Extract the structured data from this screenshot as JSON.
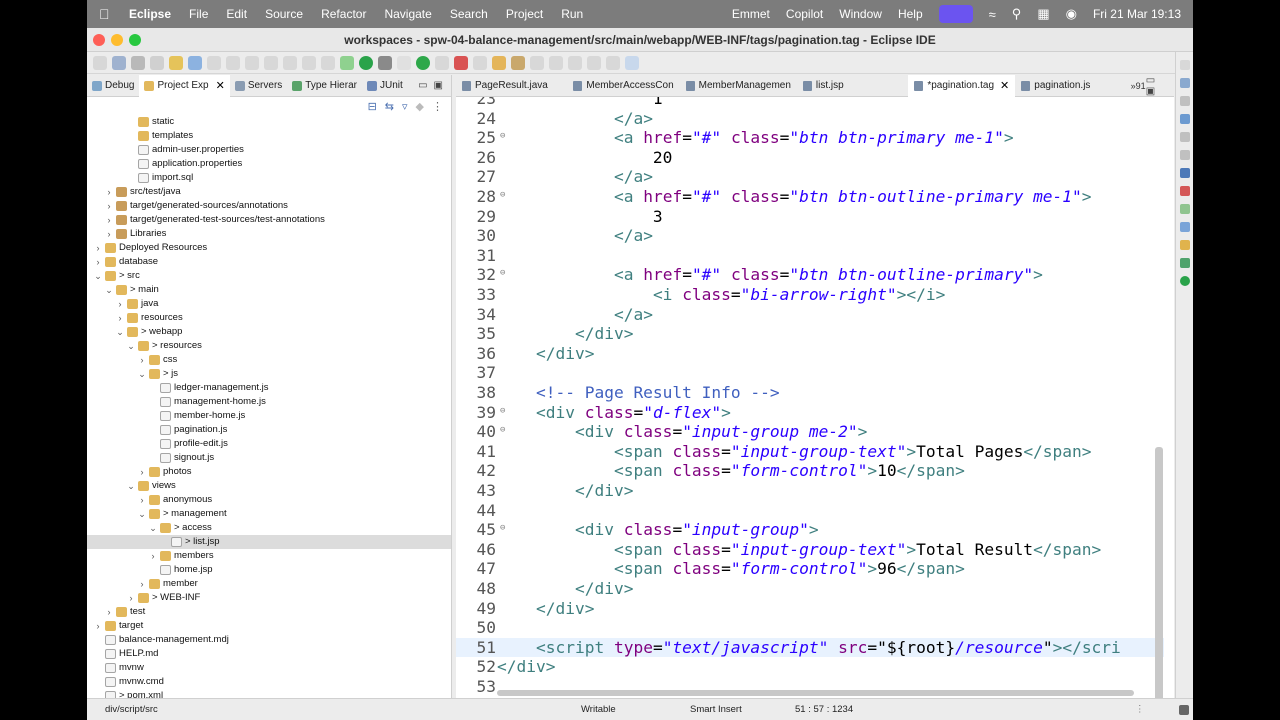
{
  "menubar": {
    "app_name": "Eclipse",
    "items": [
      "File",
      "Edit",
      "Source",
      "Refactor",
      "Navigate",
      "Search",
      "Project",
      "Run"
    ],
    "right_items": [
      "Emmet",
      "Copilot",
      "Window",
      "Help"
    ],
    "datetime": "Fri 21 Mar  19:13"
  },
  "window": {
    "title": "workspaces - spw-04-balance-management/src/main/webapp/WEB-INF/tags/pagination.tag - Eclipse IDE"
  },
  "left_tabs": [
    {
      "label": "Debug",
      "icon": "bug-icon"
    },
    {
      "label": "Project Exp",
      "icon": "project-explorer-icon",
      "active": true
    },
    {
      "label": "Servers",
      "icon": "servers-icon"
    },
    {
      "label": "Type Hierar",
      "icon": "type-hierarchy-icon"
    },
    {
      "label": "JUnit",
      "icon": "junit-icon"
    }
  ],
  "tree": [
    {
      "label": "static",
      "depth": 3,
      "kind": "folder"
    },
    {
      "label": "templates",
      "depth": 3,
      "kind": "folder"
    },
    {
      "label": "admin-user.properties",
      "depth": 3,
      "kind": "file"
    },
    {
      "label": "application.properties",
      "depth": 3,
      "kind": "file"
    },
    {
      "label": "import.sql",
      "depth": 3,
      "kind": "file"
    },
    {
      "label": "src/test/java",
      "depth": 1,
      "kind": "proj",
      "twisty": ">"
    },
    {
      "label": "target/generated-sources/annotations",
      "depth": 1,
      "kind": "proj",
      "twisty": ">"
    },
    {
      "label": "target/generated-test-sources/test-annotations",
      "depth": 1,
      "kind": "proj",
      "twisty": ">"
    },
    {
      "label": "Libraries",
      "depth": 1,
      "kind": "proj",
      "twisty": ">"
    },
    {
      "label": "Deployed Resources",
      "depth": 0,
      "kind": "folder",
      "twisty": ">"
    },
    {
      "label": "database",
      "depth": 0,
      "kind": "folder",
      "twisty": ">"
    },
    {
      "label": "> src",
      "depth": 0,
      "kind": "folder",
      "twisty": "v"
    },
    {
      "label": "> main",
      "depth": 1,
      "kind": "folder",
      "twisty": "v"
    },
    {
      "label": "java",
      "depth": 2,
      "kind": "folder",
      "twisty": ">"
    },
    {
      "label": "resources",
      "depth": 2,
      "kind": "folder",
      "twisty": ">"
    },
    {
      "label": "> webapp",
      "depth": 2,
      "kind": "folder",
      "twisty": "v"
    },
    {
      "label": "> resources",
      "depth": 3,
      "kind": "folder",
      "twisty": "v"
    },
    {
      "label": "css",
      "depth": 4,
      "kind": "folder",
      "twisty": ">"
    },
    {
      "label": "> js",
      "depth": 4,
      "kind": "folder",
      "twisty": "v"
    },
    {
      "label": "ledger-management.js",
      "depth": 5,
      "kind": "file"
    },
    {
      "label": "management-home.js",
      "depth": 5,
      "kind": "file"
    },
    {
      "label": "member-home.js",
      "depth": 5,
      "kind": "file"
    },
    {
      "label": "pagination.js",
      "depth": 5,
      "kind": "file"
    },
    {
      "label": "profile-edit.js",
      "depth": 5,
      "kind": "file"
    },
    {
      "label": "signout.js",
      "depth": 5,
      "kind": "file"
    },
    {
      "label": "photos",
      "depth": 4,
      "kind": "folder",
      "twisty": ">"
    },
    {
      "label": "views",
      "depth": 3,
      "kind": "folder",
      "twisty": "v"
    },
    {
      "label": "anonymous",
      "depth": 4,
      "kind": "folder",
      "twisty": ">"
    },
    {
      "label": "> management",
      "depth": 4,
      "kind": "folder",
      "twisty": "v"
    },
    {
      "label": "> access",
      "depth": 5,
      "kind": "folder",
      "twisty": "v"
    },
    {
      "label": "> list.jsp",
      "depth": 6,
      "kind": "file",
      "selected": true
    },
    {
      "label": "members",
      "depth": 5,
      "kind": "folder",
      "twisty": ">"
    },
    {
      "label": "home.jsp",
      "depth": 5,
      "kind": "file"
    },
    {
      "label": "member",
      "depth": 4,
      "kind": "folder",
      "twisty": ">"
    },
    {
      "label": "> WEB-INF",
      "depth": 3,
      "kind": "folder",
      "twisty": ">"
    },
    {
      "label": "test",
      "depth": 1,
      "kind": "folder",
      "twisty": ">"
    },
    {
      "label": "target",
      "depth": 0,
      "kind": "folder",
      "twisty": ">"
    },
    {
      "label": "balance-management.mdj",
      "depth": 0,
      "kind": "file"
    },
    {
      "label": "HELP.md",
      "depth": 0,
      "kind": "file"
    },
    {
      "label": "mvnw",
      "depth": 0,
      "kind": "file"
    },
    {
      "label": "mvnw.cmd",
      "depth": 0,
      "kind": "file"
    },
    {
      "label": "> pom.xml",
      "depth": 0,
      "kind": "file"
    }
  ],
  "editor_tabs": [
    {
      "label": "PageResult.java"
    },
    {
      "label": "MemberAccessCon"
    },
    {
      "label": "MemberManagemen"
    },
    {
      "label": "list.jsp"
    },
    {
      "label": "*pagination.tag",
      "active": true
    },
    {
      "label": "pagination.js"
    }
  ],
  "editor_overflow": "»91",
  "code_lines": [
    {
      "n": "23",
      "segs": [
        [
          "x",
          "                1"
        ]
      ]
    },
    {
      "n": "24",
      "segs": [
        [
          "x",
          "            "
        ],
        [
          "t",
          "</a>"
        ]
      ]
    },
    {
      "n": "25",
      "fold": true,
      "segs": [
        [
          "x",
          "            "
        ],
        [
          "t",
          "<a "
        ],
        [
          "a",
          "href"
        ],
        [
          "x",
          "="
        ],
        [
          "v",
          "\"#\""
        ],
        [
          "x",
          " "
        ],
        [
          "a",
          "class"
        ],
        [
          "x",
          "="
        ],
        [
          "v",
          "\"btn btn-primary me-1\""
        ],
        [
          "t",
          ">"
        ]
      ]
    },
    {
      "n": "26",
      "segs": [
        [
          "x",
          "                20"
        ]
      ]
    },
    {
      "n": "27",
      "segs": [
        [
          "x",
          "            "
        ],
        [
          "t",
          "</a>"
        ]
      ]
    },
    {
      "n": "28",
      "fold": true,
      "segs": [
        [
          "x",
          "            "
        ],
        [
          "t",
          "<a "
        ],
        [
          "a",
          "href"
        ],
        [
          "x",
          "="
        ],
        [
          "v",
          "\"#\""
        ],
        [
          "x",
          " "
        ],
        [
          "a",
          "class"
        ],
        [
          "x",
          "="
        ],
        [
          "v",
          "\"btn btn-outline-primary me-1\""
        ],
        [
          "t",
          ">"
        ]
      ]
    },
    {
      "n": "29",
      "segs": [
        [
          "x",
          "                3"
        ]
      ]
    },
    {
      "n": "30",
      "segs": [
        [
          "x",
          "            "
        ],
        [
          "t",
          "</a>"
        ]
      ]
    },
    {
      "n": "31",
      "segs": []
    },
    {
      "n": "32",
      "fold": true,
      "segs": [
        [
          "x",
          "            "
        ],
        [
          "t",
          "<a "
        ],
        [
          "a",
          "href"
        ],
        [
          "x",
          "="
        ],
        [
          "v",
          "\"#\""
        ],
        [
          "x",
          " "
        ],
        [
          "a",
          "class"
        ],
        [
          "x",
          "="
        ],
        [
          "v",
          "\"btn btn-outline-primary\""
        ],
        [
          "t",
          ">"
        ]
      ]
    },
    {
      "n": "33",
      "segs": [
        [
          "x",
          "                "
        ],
        [
          "t",
          "<i "
        ],
        [
          "a",
          "class"
        ],
        [
          "x",
          "="
        ],
        [
          "v",
          "\"bi-arrow-right\""
        ],
        [
          "t",
          "></i>"
        ]
      ]
    },
    {
      "n": "34",
      "segs": [
        [
          "x",
          "            "
        ],
        [
          "t",
          "</a>"
        ]
      ]
    },
    {
      "n": "35",
      "segs": [
        [
          "x",
          "        "
        ],
        [
          "t",
          "</div>"
        ]
      ]
    },
    {
      "n": "36",
      "segs": [
        [
          "x",
          "    "
        ],
        [
          "t",
          "</div>"
        ]
      ]
    },
    {
      "n": "37",
      "segs": []
    },
    {
      "n": "38",
      "segs": [
        [
          "x",
          "    "
        ],
        [
          "c",
          "<!-- Page Result Info -->"
        ]
      ]
    },
    {
      "n": "39",
      "fold": true,
      "segs": [
        [
          "x",
          "    "
        ],
        [
          "t",
          "<div "
        ],
        [
          "a",
          "class"
        ],
        [
          "x",
          "="
        ],
        [
          "v",
          "\"d-flex\""
        ],
        [
          "t",
          ">"
        ]
      ]
    },
    {
      "n": "40",
      "fold": true,
      "segs": [
        [
          "x",
          "        "
        ],
        [
          "t",
          "<div "
        ],
        [
          "a",
          "class"
        ],
        [
          "x",
          "="
        ],
        [
          "v",
          "\"input-group me-2\""
        ],
        [
          "t",
          ">"
        ]
      ]
    },
    {
      "n": "41",
      "segs": [
        [
          "x",
          "            "
        ],
        [
          "t",
          "<span "
        ],
        [
          "a",
          "class"
        ],
        [
          "x",
          "="
        ],
        [
          "v",
          "\"input-group-text\""
        ],
        [
          "t",
          ">"
        ],
        [
          "x",
          "Total Pages"
        ],
        [
          "t",
          "</span>"
        ]
      ]
    },
    {
      "n": "42",
      "segs": [
        [
          "x",
          "            "
        ],
        [
          "t",
          "<span "
        ],
        [
          "a",
          "class"
        ],
        [
          "x",
          "="
        ],
        [
          "v",
          "\"form-control\""
        ],
        [
          "t",
          ">"
        ],
        [
          "x",
          "10"
        ],
        [
          "t",
          "</span>"
        ]
      ]
    },
    {
      "n": "43",
      "segs": [
        [
          "x",
          "        "
        ],
        [
          "t",
          "</div>"
        ]
      ]
    },
    {
      "n": "44",
      "segs": []
    },
    {
      "n": "45",
      "fold": true,
      "segs": [
        [
          "x",
          "        "
        ],
        [
          "t",
          "<div "
        ],
        [
          "a",
          "class"
        ],
        [
          "x",
          "="
        ],
        [
          "v",
          "\"input-group\""
        ],
        [
          "t",
          ">"
        ]
      ]
    },
    {
      "n": "46",
      "segs": [
        [
          "x",
          "            "
        ],
        [
          "t",
          "<span "
        ],
        [
          "a",
          "class"
        ],
        [
          "x",
          "="
        ],
        [
          "v",
          "\"input-group-text\""
        ],
        [
          "t",
          ">"
        ],
        [
          "x",
          "Total Result"
        ],
        [
          "t",
          "</span>"
        ]
      ]
    },
    {
      "n": "47",
      "segs": [
        [
          "x",
          "            "
        ],
        [
          "t",
          "<span "
        ],
        [
          "a",
          "class"
        ],
        [
          "x",
          "="
        ],
        [
          "v",
          "\"form-control\""
        ],
        [
          "t",
          ">"
        ],
        [
          "x",
          "96"
        ],
        [
          "t",
          "</span>"
        ]
      ]
    },
    {
      "n": "48",
      "segs": [
        [
          "x",
          "        "
        ],
        [
          "t",
          "</div>"
        ]
      ]
    },
    {
      "n": "49",
      "segs": [
        [
          "x",
          "    "
        ],
        [
          "t",
          "</div>"
        ]
      ]
    },
    {
      "n": "50",
      "segs": []
    },
    {
      "n": "51",
      "current": true,
      "segs": [
        [
          "x",
          "    "
        ],
        [
          "t",
          "<script "
        ],
        [
          "a",
          "type"
        ],
        [
          "x",
          "="
        ],
        [
          "v",
          "\"text/javascript\""
        ],
        [
          "x",
          " "
        ],
        [
          "a",
          "src"
        ],
        [
          "x",
          "=\""
        ],
        [
          "x",
          "${root}"
        ],
        [
          "v",
          "/resource"
        ],
        [
          "x",
          "\""
        ],
        [
          "t",
          "></scri"
        ]
      ]
    },
    {
      "n": "52",
      "segs": [
        [
          "t",
          "</div>"
        ]
      ]
    },
    {
      "n": "53",
      "segs": []
    }
  ],
  "status": {
    "path": "div/script/src",
    "mode": "Writable",
    "insert": "Smart Insert",
    "position": "51 : 57 : 1234"
  },
  "colors": {
    "tag": "#3f7f7f",
    "attr": "#7f007f",
    "value": "#2a00ff",
    "comment": "#3f5fbf",
    "menubar": "#7c7c7c"
  }
}
